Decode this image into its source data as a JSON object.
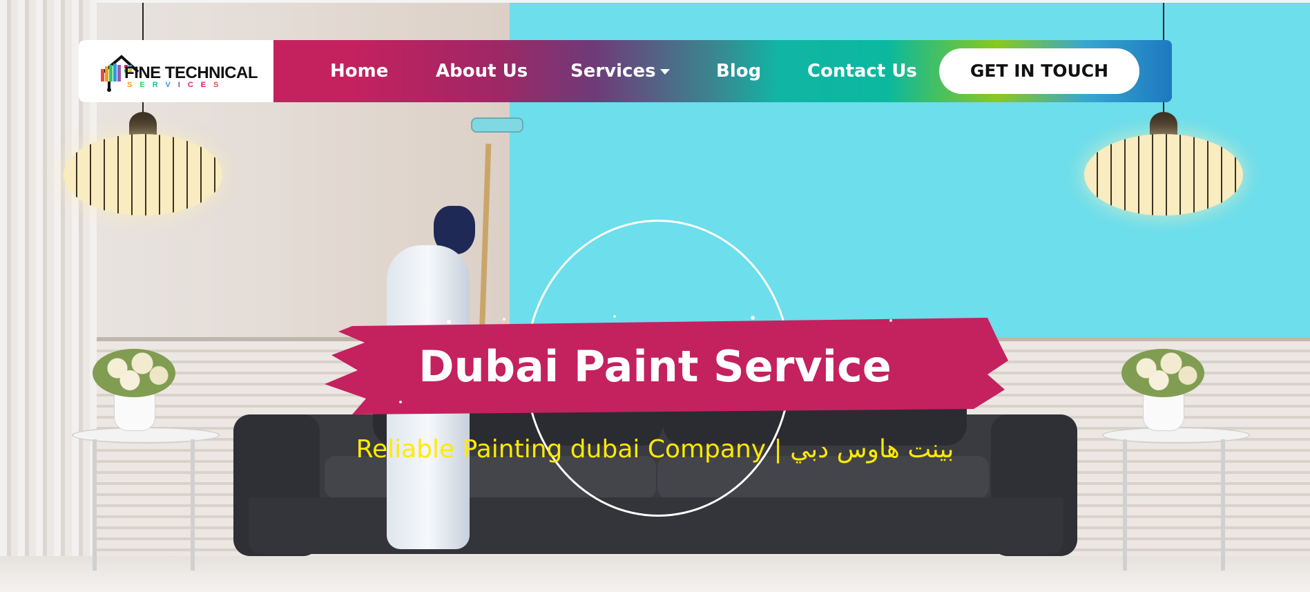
{
  "brand": {
    "logo_title": "FINE TECHNICAL",
    "logo_sub_letters": [
      "S",
      "E",
      "R",
      "V",
      "I",
      "C",
      "E",
      "S"
    ],
    "logo_sub_colors": [
      "#f39c12",
      "#2ecc71",
      "#1abc9c",
      "#3498db",
      "#8e44ad",
      "#e91e63",
      "#c4215f",
      "#e74c3c"
    ]
  },
  "nav": {
    "items": [
      {
        "label": "Home"
      },
      {
        "label": "About Us"
      },
      {
        "label": "Services",
        "icon": "caret-down-icon"
      },
      {
        "label": "Blog"
      },
      {
        "label": "Contact Us"
      }
    ],
    "cta_label": "GET IN TOUCH"
  },
  "hero": {
    "title": "Dubai Paint Service",
    "subtitle": "Reliable Painting dubai Company | بينت هاوس دبي",
    "title_color": "#ffffff",
    "subtitle_color": "#ffea00",
    "brush_color": "#c4215f",
    "accent_wall_color": "#6cdeec"
  }
}
